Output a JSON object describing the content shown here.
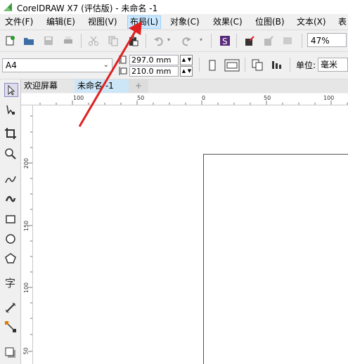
{
  "window": {
    "title": "CorelDRAW X7 (评估版) - 未命名 -1"
  },
  "menu": {
    "items": [
      {
        "label": "文件(F)"
      },
      {
        "label": "编辑(E)"
      },
      {
        "label": "视图(V)"
      },
      {
        "label": "布局(L)"
      },
      {
        "label": "对象(C)"
      },
      {
        "label": "效果(C)"
      },
      {
        "label": "位图(B)"
      },
      {
        "label": "文本(X)"
      },
      {
        "label": "表"
      }
    ]
  },
  "toolbar": {
    "zoom": "47%"
  },
  "property_bar": {
    "page_size": "A4",
    "width": "297.0 mm",
    "height": "210.0 mm",
    "unit_label": "单位:",
    "unit_value": "毫米"
  },
  "tabs": [
    {
      "label": "欢迎屏幕"
    },
    {
      "label": "未命名 -1"
    },
    {
      "label": "+"
    }
  ],
  "rulers": {
    "horizontal": [
      "100",
      "50",
      "0",
      "50",
      "100"
    ],
    "vertical": [
      "200",
      "150",
      "100",
      "50"
    ]
  },
  "colors": {
    "active_menu_bg": "#cce8ff",
    "active_tab_bg": "#cde6f7",
    "annotation_arrow": "#e02020"
  }
}
